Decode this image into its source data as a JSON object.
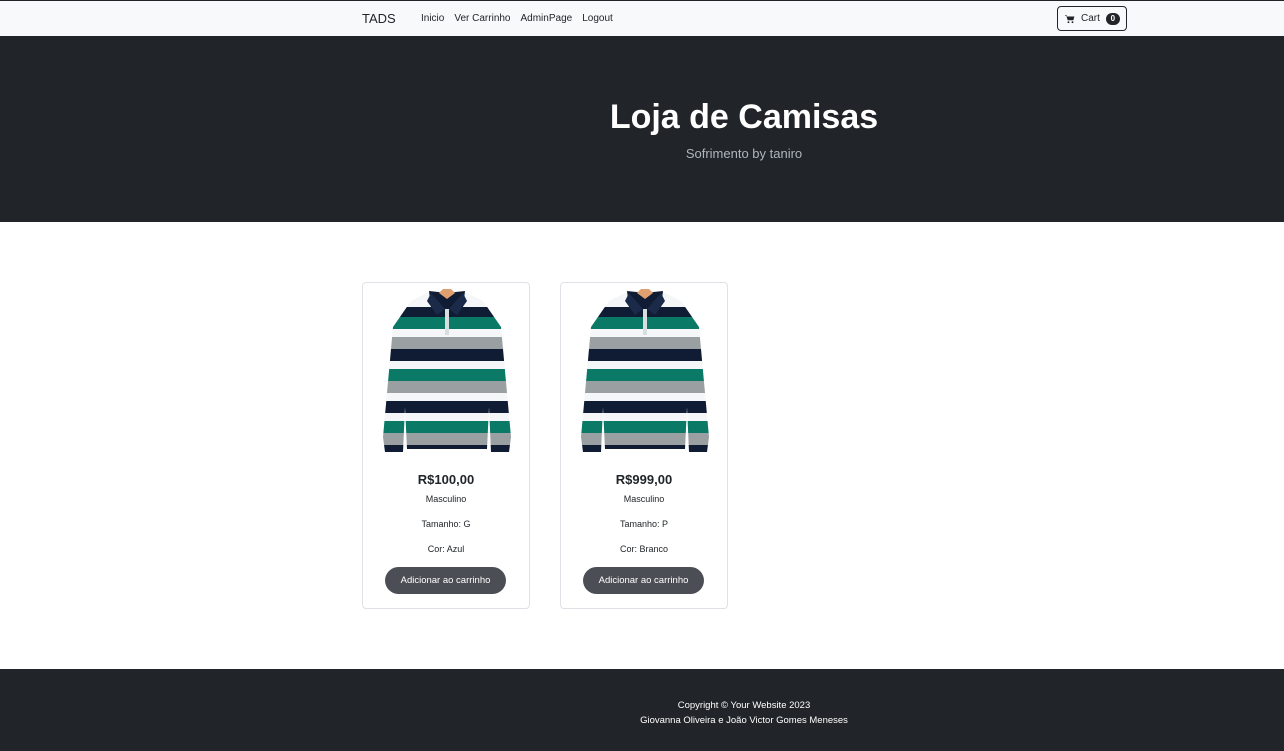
{
  "nav": {
    "brand": "TADS",
    "links": [
      "Inicio",
      "Ver Carrinho",
      "AdminPage",
      "Logout"
    ],
    "cart_label": "Cart",
    "cart_count": "0",
    "cart_icon": "cart-icon"
  },
  "hero": {
    "title": "Loja de Camisas",
    "subtitle": "Sofrimento by taniro"
  },
  "products": [
    {
      "image_icon": "striped-polo-shirt",
      "price": "R$100,00",
      "gender": "Masculino",
      "size": "Tamanho: G",
      "color": "Cor: Azul",
      "button": "Adicionar ao carrinho"
    },
    {
      "image_icon": "striped-polo-shirt",
      "price": "R$999,00",
      "gender": "Masculino",
      "size": "Tamanho: P",
      "color": "Cor: Branco",
      "button": "Adicionar ao carrinho"
    }
  ],
  "footer": {
    "copyright": "Copyright © Your Website 2023",
    "authors": "Giovanna Oliveira e João Victor Gomes Meneses"
  },
  "colors": {
    "dark": "#212529",
    "light": "#f8f9fa",
    "button": "#4b4f55",
    "stripe_navy": "#0f1c33",
    "stripe_teal": "#0a7a66",
    "stripe_gray": "#9aa0a2"
  }
}
